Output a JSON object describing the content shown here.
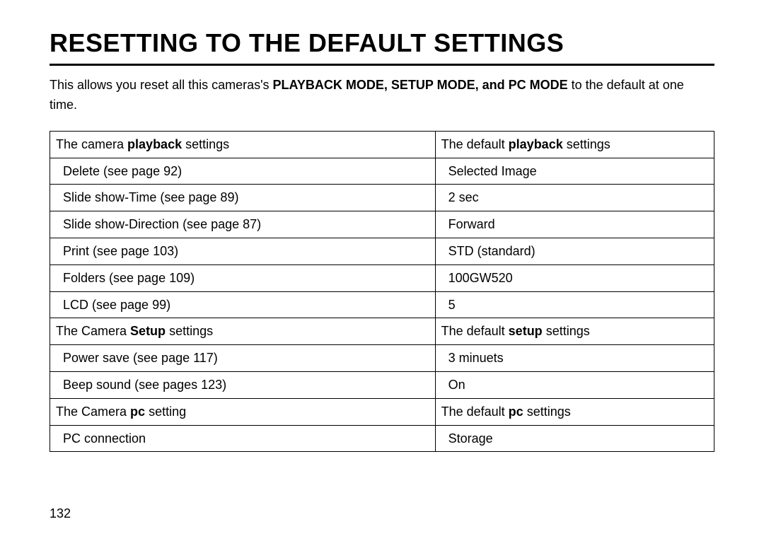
{
  "title": "RESETTING TO THE DEFAULT SETTINGS",
  "intro": {
    "before": "This allows you reset all this cameras's ",
    "bold": "PLAYBACK MODE, SETUP MODE, and PC MODE",
    "after": " to the default at one time."
  },
  "rows": [
    {
      "l_pre": "The camera ",
      "l_bold": "playback",
      "l_post": " settings",
      "r_pre": "The default ",
      "r_bold": "playback",
      "r_post": " settings",
      "header": true
    },
    {
      "l": "Delete (see page 92)",
      "r": "Selected Image"
    },
    {
      "l": "Slide show-Time (see page 89)",
      "r": "2 sec"
    },
    {
      "l": "Slide show-Direction (see page 87)",
      "r": "Forward"
    },
    {
      "l": "Print (see page 103)",
      "r": "STD (standard)"
    },
    {
      "l": "Folders (see page 109)",
      "r": "100GW520"
    },
    {
      "l": "LCD (see page 99)",
      "r": "5"
    },
    {
      "l_pre": "The Camera ",
      "l_bold": "Setup",
      "l_post": " settings",
      "r_pre": "The default ",
      "r_bold": "setup",
      "r_post": " settings",
      "header": true
    },
    {
      "l": "Power save (see page 117)",
      "r": "3 minuets"
    },
    {
      "l": "Beep sound (see pages 123)",
      "r": "On"
    },
    {
      "l_pre": "The Camera ",
      "l_bold": "pc",
      "l_post": " setting",
      "r_pre": "The default ",
      "r_bold": "pc",
      "r_post": " settings",
      "header": true
    },
    {
      "l": "PC connection",
      "r": "Storage"
    }
  ],
  "page_number": "132",
  "chart_data": {
    "type": "table",
    "columns": [
      "Setting",
      "Default"
    ],
    "sections": [
      {
        "name": "playback",
        "rows": [
          [
            "Delete (see page 92)",
            "Selected Image"
          ],
          [
            "Slide show-Time (see page 89)",
            "2 sec"
          ],
          [
            "Slide show-Direction (see page 87)",
            "Forward"
          ],
          [
            "Print (see page 103)",
            "STD (standard)"
          ],
          [
            "Folders (see page 109)",
            "100GW520"
          ],
          [
            "LCD (see page 99)",
            "5"
          ]
        ]
      },
      {
        "name": "setup",
        "rows": [
          [
            "Power save (see page 117)",
            "3 minuets"
          ],
          [
            "Beep sound (see pages 123)",
            "On"
          ]
        ]
      },
      {
        "name": "pc",
        "rows": [
          [
            "PC connection",
            "Storage"
          ]
        ]
      }
    ]
  }
}
